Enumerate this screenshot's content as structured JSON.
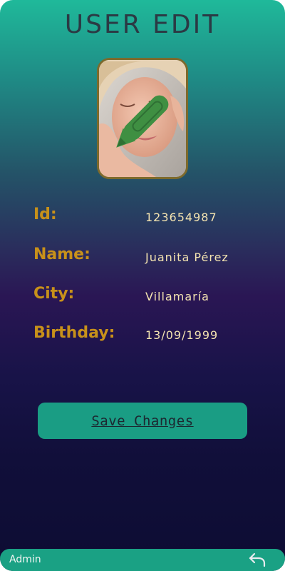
{
  "header": {
    "title": "USER EDIT"
  },
  "avatar": {
    "icon": "edit-pencil-icon",
    "icon_color": "#3f8f42",
    "frame_color": "#7d6a2c"
  },
  "fields": [
    {
      "label": "Id:",
      "value": "123654987"
    },
    {
      "label": "Name:",
      "value": "Juanita Pérez"
    },
    {
      "label": "City:",
      "value": "Villamaría"
    },
    {
      "label": "Birthday:",
      "value": "13/09/1999"
    }
  ],
  "actions": {
    "save_label": "Save Changes"
  },
  "footer": {
    "user": "Admin",
    "back_icon": "undo-arrow-icon"
  },
  "colors": {
    "label": "#c8911a",
    "value": "#f3e3b0",
    "button": "#1a9d84",
    "footer": "#1aa184",
    "title": "#2b3a44"
  }
}
